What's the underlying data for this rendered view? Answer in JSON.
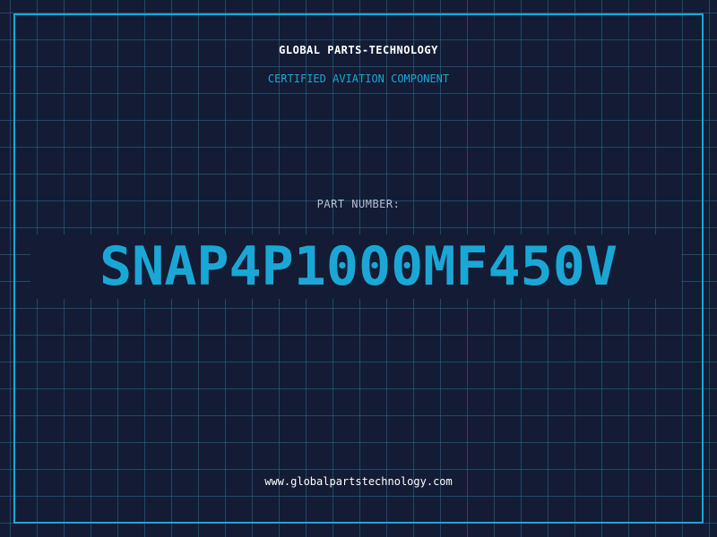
{
  "header": {
    "brand": "GLOBAL PARTS-TECHNOLOGY",
    "subtitle": "CERTIFIED AVIATION COMPONENT"
  },
  "part": {
    "label": "PART NUMBER:",
    "number": "SNAP4P1000MF450V"
  },
  "footer": {
    "website": "www.globalpartstechnology.com"
  },
  "colors": {
    "background": "#131c34",
    "grid": "#267092",
    "accent": "#1aa7d6",
    "text_primary": "#ffffff",
    "text_muted": "#b7bfd0"
  }
}
